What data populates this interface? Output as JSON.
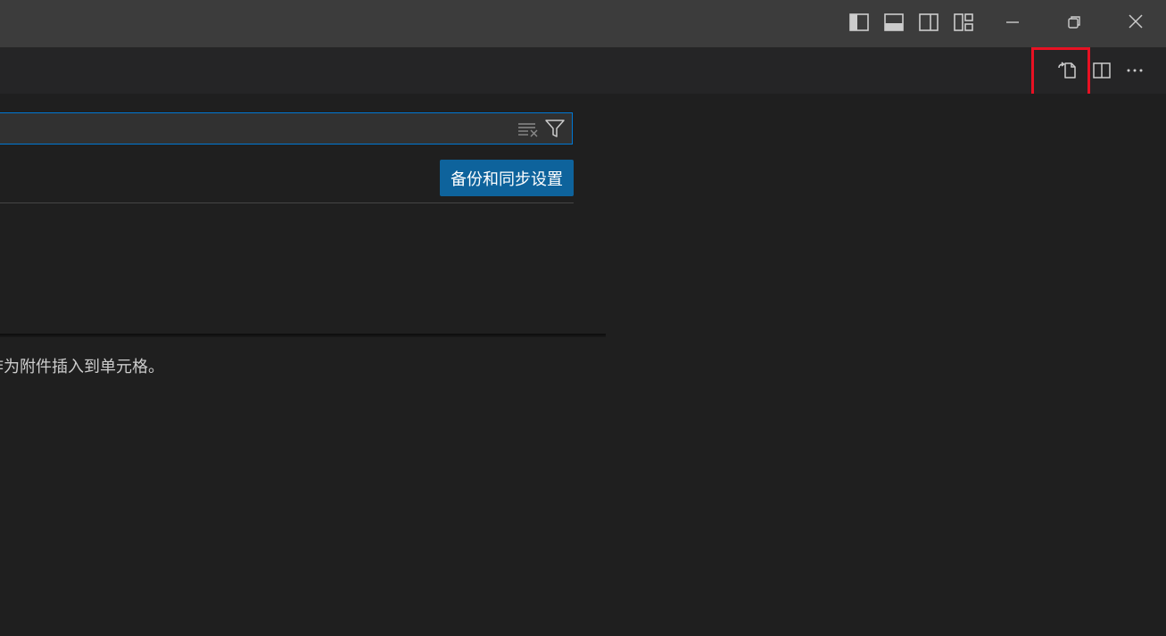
{
  "titlebar": {
    "icons": [
      "toggle-primary-sidebar-icon",
      "toggle-panel-icon",
      "toggle-secondary-sidebar-icon",
      "customize-layout-icon",
      "minimize-icon",
      "restore-icon",
      "close-icon"
    ]
  },
  "editor_actions": {
    "icons": [
      "open-settings-json-icon",
      "split-editor-icon",
      "more-actions-icon"
    ],
    "highlighted": "open-settings-json-icon",
    "highlight_color": "#e81123"
  },
  "search": {
    "value": "",
    "placeholder": "",
    "icons": [
      "clear-filter-icon",
      "filter-icon"
    ]
  },
  "sync_button": {
    "label": "备份和同步设置"
  },
  "description": {
    "text": "作为附件插入到单元格。"
  },
  "colors": {
    "titlebar_bg": "#3c3c3c",
    "tabs_bg": "#252526",
    "content_bg": "#1f1f1f",
    "accent": "#0078d4",
    "button_bg": "#0e639c"
  }
}
